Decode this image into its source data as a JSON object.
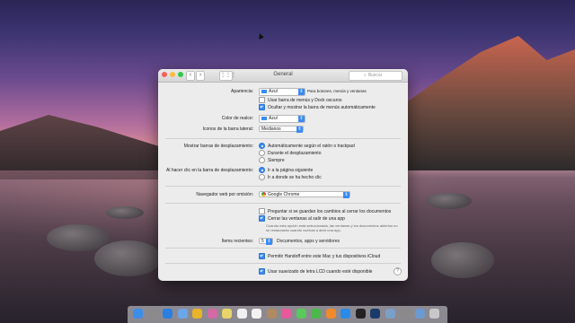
{
  "window": {
    "title": "General",
    "search_placeholder": "Buscar"
  },
  "appearance": {
    "label": "Apariencia:",
    "value": "Azul",
    "note": "Para botones, menús y ventanas",
    "dark_menu_label": "Usar barra de menús y Dock oscuros",
    "dark_menu_checked": false,
    "autohide_label": "Ocultar y mostrar la barra de menús automáticamente",
    "autohide_checked": true
  },
  "highlight": {
    "label": "Color de realce:",
    "value": "Azul"
  },
  "sidebar_icons": {
    "label": "Iconos de la barra lateral:",
    "value": "Medianos"
  },
  "scrollbars": {
    "label": "Mostrar barras de desplazamiento:",
    "options": [
      "Automáticamente según el ratón o trackpad",
      "Durante el desplazamiento",
      "Siempre"
    ],
    "selected_index": 0
  },
  "click_scroll": {
    "label": "Al hacer clic en la barra de desplazamiento:",
    "options": [
      "Ir a la página siguiente",
      "Ir a donde se ha hecho clic"
    ],
    "selected_index": 0
  },
  "browser": {
    "label": "Navegador web por omisión:",
    "value": "Google Chrome"
  },
  "documents": {
    "ask_save_label": "Preguntar si se guardan los cambios al cerrar los documentos",
    "ask_save_checked": false,
    "close_windows_label": "Cerrar las ventanas al salir de una app",
    "close_windows_checked": true,
    "close_windows_note": "Cuando esta opción está seleccionada, las ventanas y los documentos abiertos no se restaurarán cuando vuelvas a abrir una app."
  },
  "recent": {
    "label": "Ítems recientes:",
    "value": "5",
    "suffix": "Documentos, apps y servidores"
  },
  "handoff": {
    "label": "Permitir Handoff entre este Mac y tus dispositivos iCloud",
    "checked": true
  },
  "lcd": {
    "label": "Usar suavizado de letra LCD cuando esté disponible",
    "checked": true
  },
  "help_label": "?",
  "dock_icons": [
    {
      "name": "finder-icon",
      "color": "#3d8ee8"
    },
    {
      "name": "launchpad-icon",
      "color": "#8a8a8a"
    },
    {
      "name": "safari-icon",
      "color": "#2a7fe0"
    },
    {
      "name": "mail-icon",
      "color": "#6aa6e8"
    },
    {
      "name": "chrome-icon",
      "color": "#e9b32a"
    },
    {
      "name": "photos-icon",
      "color": "#d36aa4"
    },
    {
      "name": "notes-icon",
      "color": "#e8d46a"
    },
    {
      "name": "reminders-icon",
      "color": "#f0f0f0"
    },
    {
      "name": "calendar-icon",
      "color": "#f2f2f2"
    },
    {
      "name": "contacts-icon",
      "color": "#b08a60"
    },
    {
      "name": "itunes-icon",
      "color": "#e45a9a"
    },
    {
      "name": "messages-icon",
      "color": "#5ac85a"
    },
    {
      "name": "facetime-icon",
      "color": "#4bb84b"
    },
    {
      "name": "ibooks-icon",
      "color": "#f08a2a"
    },
    {
      "name": "appstore-icon",
      "color": "#2a8ae8"
    },
    {
      "name": "terminal-icon",
      "color": "#222222"
    },
    {
      "name": "photoshop-icon",
      "color": "#1a3a6a"
    },
    {
      "name": "preview-icon",
      "color": "#7aa0c8"
    },
    {
      "name": "system-preferences-icon",
      "color": "#8a8a8a"
    },
    {
      "name": "downloads-icon",
      "color": "#6a9ad0"
    },
    {
      "name": "trash-icon",
      "color": "#c8c8c8"
    }
  ]
}
